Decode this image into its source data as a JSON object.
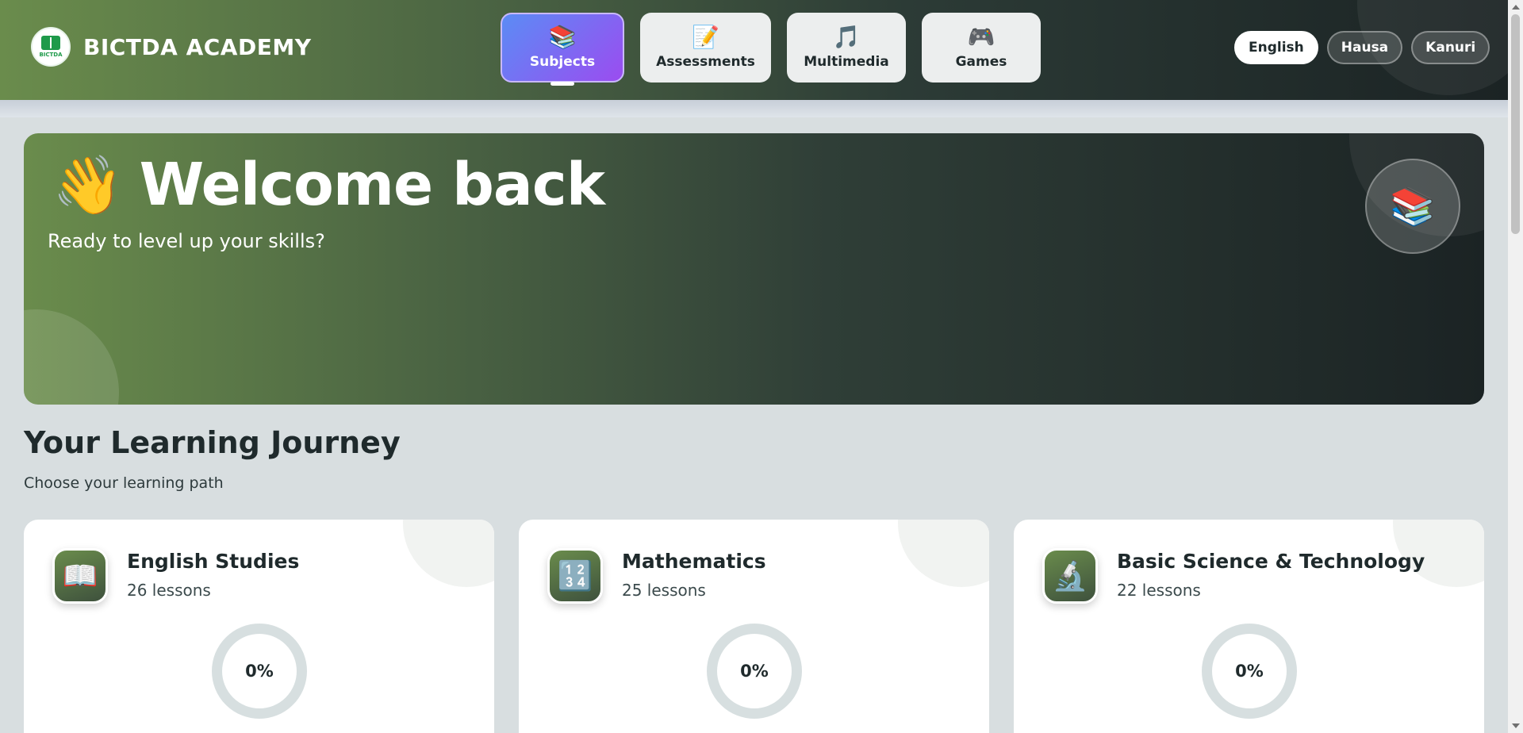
{
  "brand": {
    "name": "BICTDA ACADEMY",
    "logo_text": "BICTDA"
  },
  "nav": {
    "tabs": [
      {
        "label": "Subjects",
        "icon": "📚",
        "active": true
      },
      {
        "label": "Assessments",
        "icon": "📝",
        "active": false
      },
      {
        "label": "Multimedia",
        "icon": "🎵",
        "active": false
      },
      {
        "label": "Games",
        "icon": "🎮",
        "active": false
      }
    ]
  },
  "languages": [
    {
      "label": "English",
      "active": true
    },
    {
      "label": "Hausa",
      "active": false
    },
    {
      "label": "Kanuri",
      "active": false
    }
  ],
  "hero": {
    "wave_icon": "👋",
    "title": "Welcome back",
    "subtitle": "Ready to level up your skills?",
    "badge_icon": "📚"
  },
  "section": {
    "title": "Your Learning Journey",
    "subtitle": "Choose your learning path"
  },
  "subjects": [
    {
      "title": "English Studies",
      "lessons": "26 lessons",
      "icon": "📖",
      "progress": "0%"
    },
    {
      "title": "Mathematics",
      "lessons": "25 lessons",
      "icon": "🔢",
      "progress": "0%"
    },
    {
      "title": "Basic Science & Technology",
      "lessons": "22 lessons",
      "icon": "🔬",
      "progress": "0%"
    }
  ],
  "colors": {
    "brand_green": "#6a8c4c",
    "dark": "#1b2324",
    "active_tab_start": "#5b8cf5",
    "active_tab_end": "#9b4cf0",
    "page_bg": "#d8dee0"
  }
}
